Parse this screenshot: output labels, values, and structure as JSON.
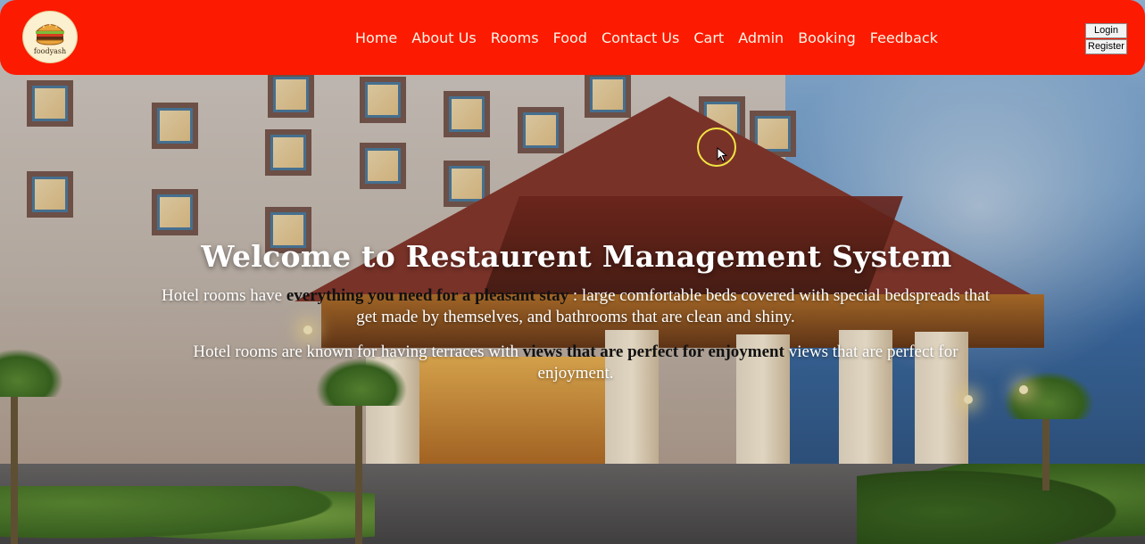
{
  "brand": {
    "logo_text": "foodyash",
    "logo_icon": "burger-icon"
  },
  "nav": {
    "items": [
      {
        "label": "Home"
      },
      {
        "label": "About Us"
      },
      {
        "label": "Rooms"
      },
      {
        "label": "Food"
      },
      {
        "label": "Contact Us"
      },
      {
        "label": "Cart"
      },
      {
        "label": "Admin"
      },
      {
        "label": "Booking"
      },
      {
        "label": "Feedback"
      }
    ]
  },
  "auth": {
    "login_label": "Login",
    "register_label": "Register"
  },
  "hero": {
    "title": "Welcome to Restaurent Management System",
    "para1": {
      "before": "Hotel rooms have ",
      "bold": "everything you need for a pleasant stay",
      "after": " : large comfortable beds covered with special bedspreads that get made by themselves, and bathrooms that are clean and shiny."
    },
    "para2": {
      "before": "Hotel rooms are known for having terraces with ",
      "bold": "views that are perfect for enjoyment",
      "after": " views that are perfect for enjoyment."
    }
  },
  "colors": {
    "navbar": "#fc1a00",
    "nav_text": "#fff6e6",
    "logo_bg": "#fbf0cf"
  }
}
